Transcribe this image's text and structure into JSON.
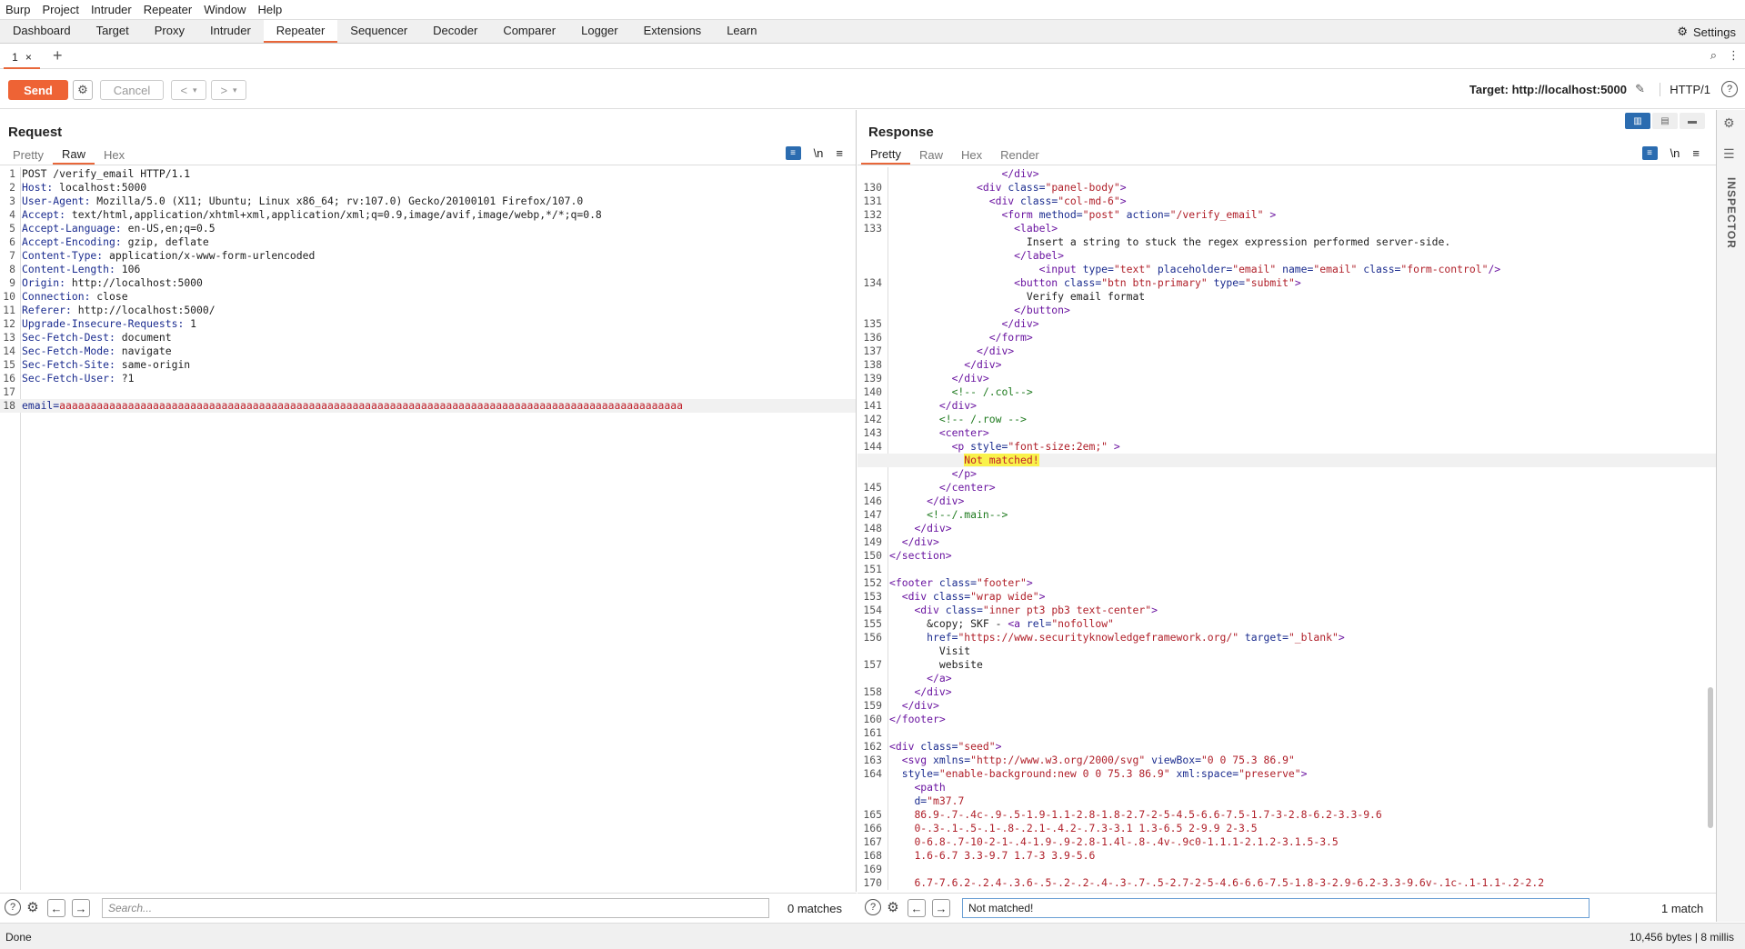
{
  "menu": [
    "Burp",
    "Project",
    "Intruder",
    "Repeater",
    "Window",
    "Help"
  ],
  "tools": [
    "Dashboard",
    "Target",
    "Proxy",
    "Intruder",
    "Repeater",
    "Sequencer",
    "Decoder",
    "Comparer",
    "Logger",
    "Extensions",
    "Learn"
  ],
  "active_tool": "Repeater",
  "settings_label": "Settings",
  "subtab": {
    "label": "1",
    "close": "×",
    "add": "+"
  },
  "actions": {
    "send": "Send",
    "cancel": "Cancel",
    "target": "Target: http://localhost:5000",
    "http_version": "HTTP/1",
    "help": "?"
  },
  "request": {
    "title": "Request",
    "tabs": [
      "Pretty",
      "Raw",
      "Hex"
    ],
    "active_tab": "Raw",
    "newline_toggle": "\\n",
    "search_placeholder": "Search...",
    "matches": "0 matches",
    "lines": [
      {
        "n": "1",
        "k": "",
        "v": "POST /verify_email HTTP/1.1"
      },
      {
        "n": "2",
        "k": "Host:",
        "v": " localhost:5000"
      },
      {
        "n": "3",
        "k": "User-Agent:",
        "v": " Mozilla/5.0 (X11; Ubuntu; Linux x86_64; rv:107.0) Gecko/20100101 Firefox/107.0"
      },
      {
        "n": "4",
        "k": "Accept:",
        "v": " text/html,application/xhtml+xml,application/xml;q=0.9,image/avif,image/webp,*/*;q=0.8"
      },
      {
        "n": "5",
        "k": "Accept-Language:",
        "v": " en-US,en;q=0.5"
      },
      {
        "n": "6",
        "k": "Accept-Encoding:",
        "v": " gzip, deflate"
      },
      {
        "n": "7",
        "k": "Content-Type:",
        "v": " application/x-www-form-urlencoded"
      },
      {
        "n": "8",
        "k": "Content-Length:",
        "v": " 106"
      },
      {
        "n": "9",
        "k": "Origin:",
        "v": " http://localhost:5000"
      },
      {
        "n": "10",
        "k": "Connection:",
        "v": " close"
      },
      {
        "n": "11",
        "k": "Referer:",
        "v": " http://localhost:5000/"
      },
      {
        "n": "12",
        "k": "Upgrade-Insecure-Requests:",
        "v": " 1"
      },
      {
        "n": "13",
        "k": "Sec-Fetch-Dest:",
        "v": " document"
      },
      {
        "n": "14",
        "k": "Sec-Fetch-Mode:",
        "v": " navigate"
      },
      {
        "n": "15",
        "k": "Sec-Fetch-Site:",
        "v": " same-origin"
      },
      {
        "n": "16",
        "k": "Sec-Fetch-User:",
        "v": " ?1"
      },
      {
        "n": "17",
        "k": "",
        "v": ""
      },
      {
        "n": "18",
        "k": "email=",
        "v": "aaaaaaaaaaaaaaaaaaaaaaaaaaaaaaaaaaaaaaaaaaaaaaaaaaaaaaaaaaaaaaaaaaaaaaaaaaaaaaaaaaaaaaaaaaaaaaaaaaaa",
        "body": true
      }
    ]
  },
  "response": {
    "title": "Response",
    "tabs": [
      "Pretty",
      "Raw",
      "Hex",
      "Render"
    ],
    "active_tab": "Pretty",
    "newline_toggle": "\\n",
    "search_value": "Not matched!",
    "matches": "1 match",
    "lines": [
      {
        "n": "",
        "h": "                  <span class=tg>&lt;/div&gt;</span>"
      },
      {
        "n": "130",
        "h": "              <span class=tg>&lt;div</span> <span class=at>class=</span><span class=av>\"panel-body\"</span><span class=tg>&gt;</span>"
      },
      {
        "n": "131",
        "h": "                <span class=tg>&lt;div</span> <span class=at>class=</span><span class=av>\"col-md-6\"</span><span class=tg>&gt;</span>"
      },
      {
        "n": "132",
        "h": "                  <span class=tg>&lt;form</span> <span class=at>method=</span><span class=av>\"post\"</span> <span class=at>action=</span><span class=av>\"/verify_email\"</span> <span class=tg>&gt;</span>"
      },
      {
        "n": "133",
        "h": "                    <span class=tg>&lt;label&gt;</span>"
      },
      {
        "n": "",
        "h": "                      Insert a string to stuck the regex expression performed server-side."
      },
      {
        "n": "",
        "h": "                    <span class=tg>&lt;/label&gt;</span>"
      },
      {
        "n": "",
        "h": "                        <span class=tg>&lt;input</span> <span class=at>type=</span><span class=av>\"text\"</span> <span class=at>placeholder=</span><span class=av>\"email\"</span> <span class=at>name=</span><span class=av>\"email\"</span> <span class=at>class=</span><span class=av>\"form-control\"</span><span class=tg>/&gt;</span>"
      },
      {
        "n": "134",
        "h": "                    <span class=tg>&lt;button</span> <span class=at>class=</span><span class=av>\"btn btn-primary\"</span> <span class=at>type=</span><span class=av>\"submit\"</span><span class=tg>&gt;</span>"
      },
      {
        "n": "",
        "h": "                      Verify email format"
      },
      {
        "n": "",
        "h": "                    <span class=tg>&lt;/button&gt;</span>"
      },
      {
        "n": "135",
        "h": "                  <span class=tg>&lt;/div&gt;</span>"
      },
      {
        "n": "136",
        "h": "                <span class=tg>&lt;/form&gt;</span>"
      },
      {
        "n": "137",
        "h": "              <span class=tg>&lt;/div&gt;</span>"
      },
      {
        "n": "138",
        "h": "            <span class=tg>&lt;/div&gt;</span>"
      },
      {
        "n": "139",
        "h": "          <span class=tg>&lt;/div&gt;</span>"
      },
      {
        "n": "140",
        "h": "          <span class=cm>&lt;!-- /.col--&gt;</span>"
      },
      {
        "n": "141",
        "h": "        <span class=tg>&lt;/div&gt;</span>"
      },
      {
        "n": "142",
        "h": "        <span class=cm>&lt;!-- /.row --&gt;</span>"
      },
      {
        "n": "143",
        "h": "        <span class=tg>&lt;center&gt;</span>"
      },
      {
        "n": "144",
        "h": "          <span class=tg>&lt;p</span> <span class=at>style=</span><span class=av>\"font-size:2em;\"</span> <span class=tg>&gt;</span>"
      },
      {
        "n": "",
        "h": "            <span class=\"red mark\">Not matched!</span>",
        "hl": true
      },
      {
        "n": "",
        "h": "          <span class=tg>&lt;/p&gt;</span>"
      },
      {
        "n": "145",
        "h": "        <span class=tg>&lt;/center&gt;</span>"
      },
      {
        "n": "146",
        "h": "      <span class=tg>&lt;/div&gt;</span>"
      },
      {
        "n": "147",
        "h": "      <span class=cm>&lt;!--/.main--&gt;</span>"
      },
      {
        "n": "148",
        "h": "    <span class=tg>&lt;/div&gt;</span>"
      },
      {
        "n": "149",
        "h": "  <span class=tg>&lt;/div&gt;</span>"
      },
      {
        "n": "150",
        "h": "<span class=tg>&lt;/section&gt;</span>"
      },
      {
        "n": "151",
        "h": ""
      },
      {
        "n": "152",
        "h": "<span class=tg>&lt;footer</span> <span class=at>class=</span><span class=av>\"footer\"</span><span class=tg>&gt;</span>"
      },
      {
        "n": "153",
        "h": "  <span class=tg>&lt;div</span> <span class=at>class=</span><span class=av>\"wrap wide\"</span><span class=tg>&gt;</span>"
      },
      {
        "n": "154",
        "h": "    <span class=tg>&lt;div</span> <span class=at>class=</span><span class=av>\"inner pt3 pb3 text-center\"</span><span class=tg>&gt;</span>"
      },
      {
        "n": "155",
        "h": "      &amp;copy; SKF - <span class=tg>&lt;a</span> <span class=at>rel=</span><span class=av>\"nofollow\"</span>"
      },
      {
        "n": "156",
        "h": "      <span class=at>href=</span><span class=av>\"https://www.securityknowledgeframework.org/\"</span> <span class=at>target=</span><span class=av>\"_blank\"</span><span class=tg>&gt;</span>"
      },
      {
        "n": "",
        "h": "        Visit"
      },
      {
        "n": "157",
        "h": "        website"
      },
      {
        "n": "",
        "h": "      <span class=tg>&lt;/a&gt;</span>"
      },
      {
        "n": "158",
        "h": "    <span class=tg>&lt;/div&gt;</span>"
      },
      {
        "n": "159",
        "h": "  <span class=tg>&lt;/div&gt;</span>"
      },
      {
        "n": "160",
        "h": "<span class=tg>&lt;/footer&gt;</span>"
      },
      {
        "n": "161",
        "h": ""
      },
      {
        "n": "162",
        "h": "<span class=tg>&lt;div</span> <span class=at>class=</span><span class=av>\"seed\"</span><span class=tg>&gt;</span>"
      },
      {
        "n": "163",
        "h": "  <span class=tg>&lt;svg</span> <span class=at>xmlns=</span><span class=av>\"http://www.w3.org/2000/svg\"</span> <span class=at>viewBox=</span><span class=av>\"0 0 75.3 86.9\"</span>"
      },
      {
        "n": "164",
        "h": "  <span class=at>style=</span><span class=av>\"enable-background:new 0 0 75.3 86.9\"</span> <span class=at>xml:space=</span><span class=av>\"preserve\"</span><span class=tg>&gt;</span>"
      },
      {
        "n": "",
        "h": "    <span class=tg>&lt;path</span>"
      },
      {
        "n": "",
        "h": "    <span class=at>d=</span><span class=av>\"m37.7</span>"
      },
      {
        "n": "165",
        "h": "    <span class=av>86.9-.7-.4c-.9-.5-1.9-1.1-2.8-1.8-2.7-2-5-4.5-6.6-7.5-1.7-3-2.8-6.2-3.3-9.6</span>"
      },
      {
        "n": "166",
        "h": "    <span class=av>0-.3-.1-.5-.1-.8-.2.1-.4.2-.7.3-3.1 1.3-6.5 2-9.9 2-3.5</span>"
      },
      {
        "n": "167",
        "h": "    <span class=av>0-6.8-.7-10-2-1-.4-1.9-.9-2.8-1.4l-.8-.4v-.9c0-1.1.1-2.1.2-3.1.5-3.5</span>"
      },
      {
        "n": "168",
        "h": "    <span class=av>1.6-6.7 3.3-9.7 1.7-3 3.9-5.6</span>"
      },
      {
        "n": "169",
        "h": ""
      },
      {
        "n": "170",
        "h": "    <span class=av>6.7-7.6.2-.2.4-.3.6-.5-.2-.2-.4-.3-.7-.5-2.7-2-5-4.6-6.6-7.5-1.8-3-2.9-6.2-3.3-9.6v-.1c-.1-1.1-.2-2.2</span>"
      }
    ]
  },
  "status": {
    "left": "Done",
    "right": "10,456 bytes | 8 millis"
  },
  "inspector_label": "INSPECTOR"
}
